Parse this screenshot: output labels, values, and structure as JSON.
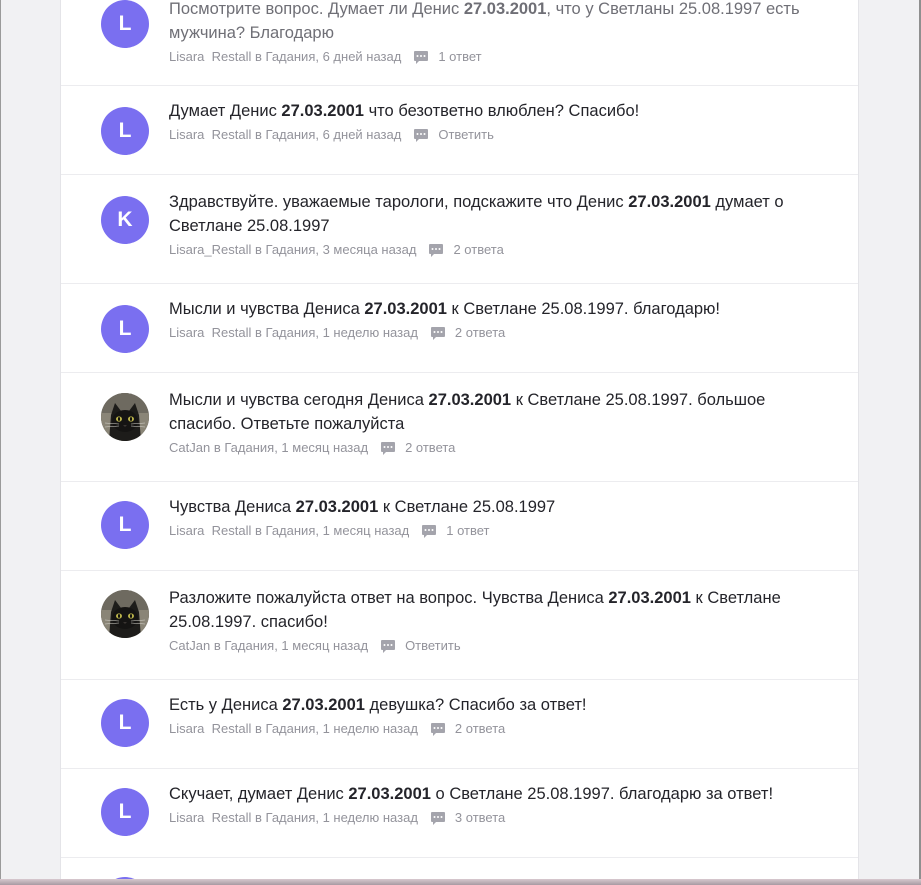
{
  "questions": [
    {
      "avatar_letter": "L",
      "avatar_type": "letter",
      "title_parts": [
        "Посмотрите вопрос. Думает ли Денис ",
        "27.03.2001",
        ", что у Светланы 25.08.1997 есть мужчина? Благодарю"
      ],
      "user": "Lisara  Restall",
      "category": "в Гадания",
      "time": ", 6 дней назад",
      "answers": "1 ответ",
      "faded": true
    },
    {
      "avatar_letter": "L",
      "avatar_type": "letter",
      "title_parts": [
        "Думает Денис ",
        "27.03.2001",
        " что безответно влюблен? Спасибо!"
      ],
      "user": "Lisara  Restall",
      "category": "в Гадания",
      "time": ", 6 дней назад",
      "answers": "Ответить"
    },
    {
      "avatar_letter": "K",
      "avatar_type": "letter",
      "title_parts": [
        "Здравствуйте. уважаемые тарологи, подскажите что Денис ",
        "27.03.2001",
        " думает о Светлане 25.08.1997"
      ],
      "user": "Lisara_Restall",
      "category": "в Гадания",
      "time": ", 3 месяца назад",
      "answers": "2 ответа"
    },
    {
      "avatar_letter": "L",
      "avatar_type": "letter",
      "title_parts": [
        "Мысли и чувства Дениса ",
        "27.03.2001",
        " к Светлане 25.08.1997. благодарю!"
      ],
      "user": "Lisara  Restall",
      "category": "в Гадания",
      "time": ", 1 неделю назад",
      "answers": "2 ответа"
    },
    {
      "avatar_letter": "",
      "avatar_type": "cat-photo",
      "title_parts": [
        "Мысли и чувства сегодня Дениса ",
        "27.03.2001",
        " к Светлане 25.08.1997. большое спасибо. Ответьте пожалуйста"
      ],
      "user": "CatJan",
      "category": "в Гадания",
      "time": ", 1 месяц назад",
      "answers": "2 ответа"
    },
    {
      "avatar_letter": "L",
      "avatar_type": "letter",
      "title_parts": [
        "Чувства Дениса ",
        "27.03.2001",
        " к Светлане 25.08.1997"
      ],
      "user": "Lisara  Restall",
      "category": "в Гадания",
      "time": ", 1 месяц назад",
      "answers": "1 ответ"
    },
    {
      "avatar_letter": "",
      "avatar_type": "cat-photo",
      "title_parts": [
        "Разложите пожалуйста ответ на вопрос. Чувства Дениса ",
        "27.03.2001",
        " к Светлане 25.08.1997. спасибо!"
      ],
      "user": "CatJan",
      "category": "в Гадания",
      "time": ", 1 месяц назад",
      "answers": "Ответить"
    },
    {
      "avatar_letter": "L",
      "avatar_type": "letter",
      "title_parts": [
        "Есть у Дениса ",
        "27.03.2001",
        " девушка? Спасибо за ответ!"
      ],
      "user": "Lisara  Restall",
      "category": "в Гадания",
      "time": ", 1 неделю назад",
      "answers": "2 ответа"
    },
    {
      "avatar_letter": "L",
      "avatar_type": "letter",
      "title_parts": [
        "Скучает, думает Денис ",
        "27.03.2001",
        " о Светлане 25.08.1997. благодарю за ответ!"
      ],
      "user": "Lisara  Restall",
      "category": "в Гадания",
      "time": ", 1 неделю назад",
      "answers": "3 ответа"
    }
  ],
  "colors": {
    "avatar_bg": "#7a6ff0",
    "meta_text": "#93939b",
    "title_text": "#24242a"
  }
}
